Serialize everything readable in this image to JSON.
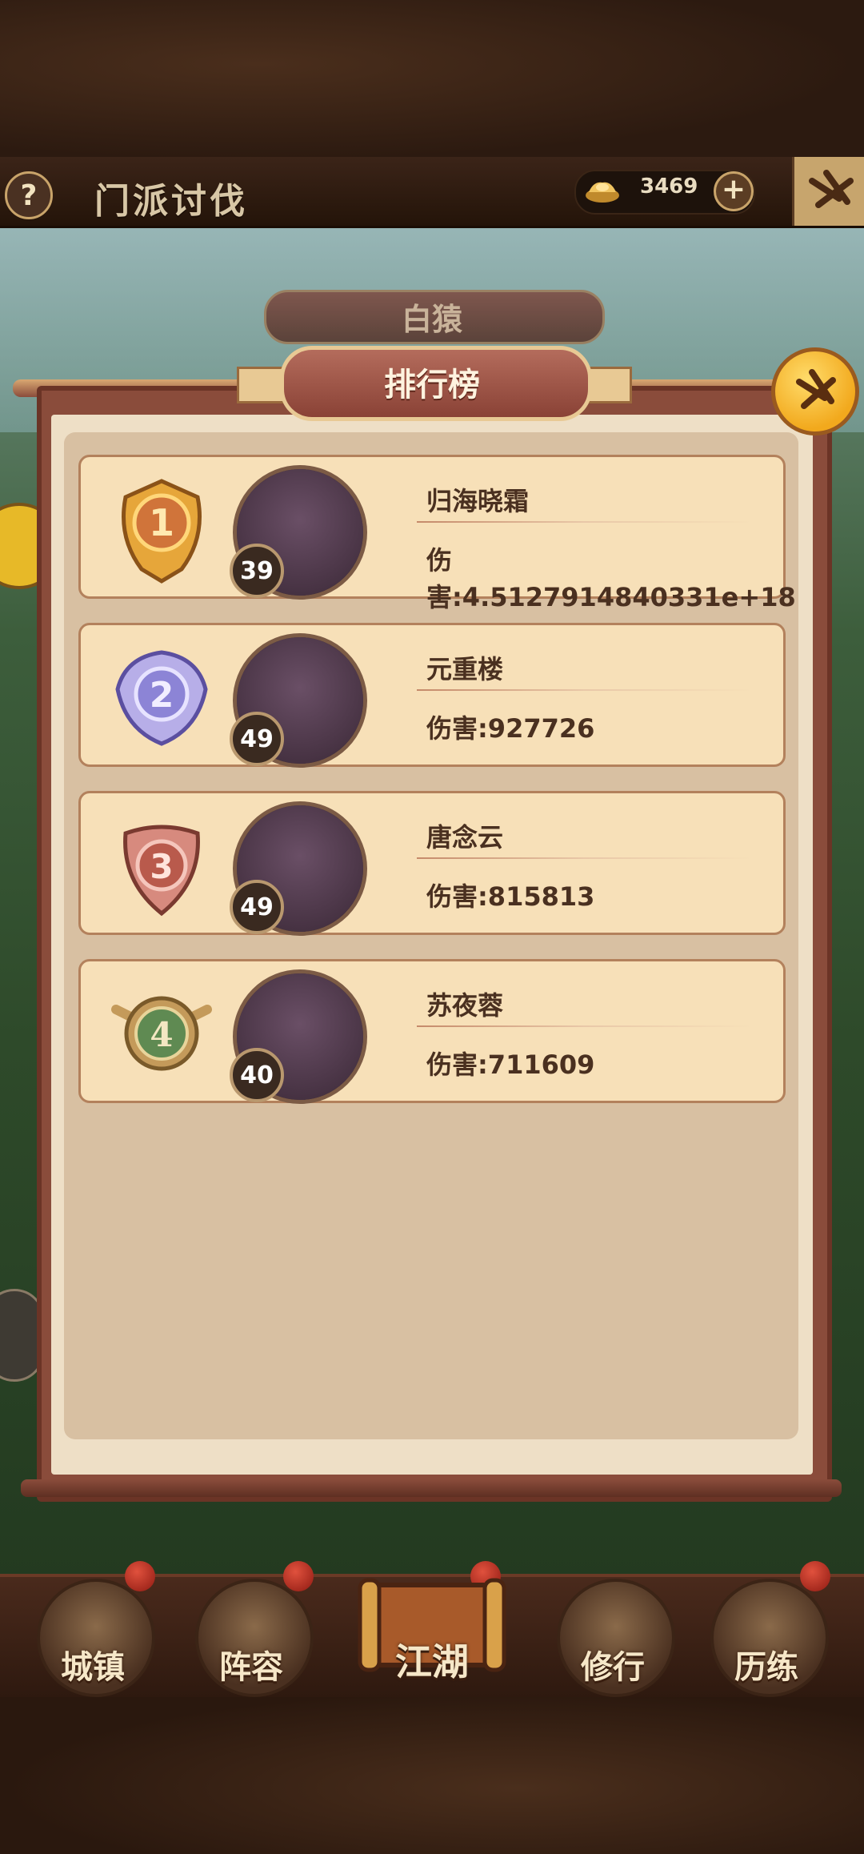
{
  "topbar": {
    "help_label": "?",
    "title": "门派讨伐",
    "currency_value": "3469",
    "currency_icon": "gold-ingot-icon",
    "plus_icon": "plus-icon",
    "exit_icon": "exit-icon"
  },
  "boss": {
    "name": "白猿"
  },
  "leaderboard": {
    "title": "排行榜",
    "close_icon": "close-icon",
    "entries": [
      {
        "rank": "1",
        "level": "39",
        "name": "归海晓霜",
        "damage": "伤害:4.5127914840331e+18"
      },
      {
        "rank": "2",
        "level": "49",
        "name": "元重楼",
        "damage": "伤害:927726"
      },
      {
        "rank": "3",
        "level": "49",
        "name": "唐念云",
        "damage": "伤害:815813"
      },
      {
        "rank": "4",
        "level": "40",
        "name": "苏夜蓉",
        "damage": "伤害:711609"
      }
    ]
  },
  "nav": {
    "items": [
      {
        "label": "城镇"
      },
      {
        "label": "阵容"
      },
      {
        "label": "江湖"
      },
      {
        "label": "修行"
      },
      {
        "label": "历练"
      }
    ]
  },
  "colors": {
    "panel_border": "#8a4c3b",
    "entry_bg": "#f7e0b8",
    "text_dark": "#4a3020",
    "gold": "#f2a91d"
  }
}
